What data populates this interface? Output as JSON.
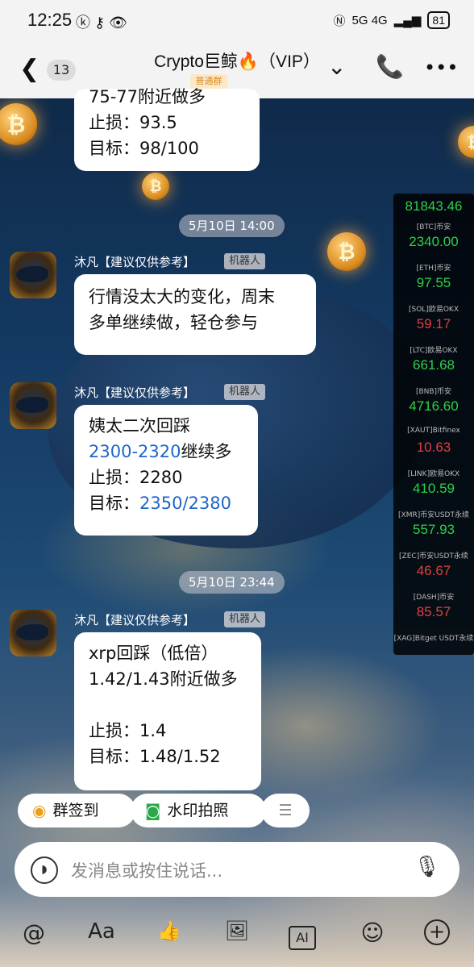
{
  "status": {
    "time": "12:25",
    "network": "5G 4G",
    "battery": "81"
  },
  "header": {
    "back_count": "13",
    "title": "Crypto巨鲸🔥（VIP）",
    "group_tag": "普通群"
  },
  "messages": {
    "top_partial": {
      "line1": "75-77附近做多",
      "line2": "止损：93.5",
      "line3": "目标：98/100"
    },
    "time1": "5月10日 14:00",
    "msg1": {
      "sender": "沐凡【建议仅供参考】",
      "badge": "机器人",
      "line1": "行情没太大的变化，周末",
      "line2": "多单继续做，轻仓参与"
    },
    "msg2": {
      "sender": "沐凡【建议仅供参考】",
      "badge": "机器人",
      "line1": "姨太二次回踩",
      "line2a": "2300-2320",
      "line2b": "继续多",
      "line3": "止损：2280",
      "line4a": "目标：",
      "line4b": "2350/2380"
    },
    "time2": "5月10日 23:44",
    "msg3": {
      "sender": "沐凡【建议仅供参考】",
      "badge": "机器人",
      "line1": "xrp回踩（低倍）",
      "line2": "1.42/1.43附近做多",
      "line3": "止损：1.4",
      "line4": "目标：1.48/1.52"
    }
  },
  "ticker": {
    "top_value": "81843.46",
    "rows": [
      {
        "label": "[BTC]币安",
        "value": "2340.00",
        "color": "#2fd04a"
      },
      {
        "label": "[ETH]币安",
        "value": "97.55",
        "color": "#2fd04a"
      },
      {
        "label": "[SOL]欧易OKX",
        "value": "59.17",
        "color": "#e04040"
      },
      {
        "label": "[LTC]欧易OKX",
        "value": "661.68",
        "color": "#2fd04a"
      },
      {
        "label": "[BNB]币安",
        "value": "4716.60",
        "color": "#2fd04a"
      },
      {
        "label": "[XAUT]Bitfinex",
        "value": "10.63",
        "color": "#e04040"
      },
      {
        "label": "[LINK]欧易OKX",
        "value": "410.59",
        "color": "#2fd04a"
      },
      {
        "label": "[XMR]币安USDT永续",
        "value": "557.93",
        "color": "#2fd04a"
      },
      {
        "label": "[ZEC]币安USDT永续",
        "value": "46.67",
        "color": "#e04040"
      },
      {
        "label": "[DASH]币安",
        "value": "85.57",
        "color": "#e04040"
      },
      {
        "label": "[XAG]Bitget USDT永续",
        "value": "",
        "color": "#2fd04a"
      }
    ]
  },
  "quick_actions": {
    "signin": "群签到",
    "photo": "水印拍照",
    "more": "☰"
  },
  "input": {
    "placeholder": "发消息或按住说话..."
  },
  "toolbar": {
    "at": "@",
    "font": "Aa",
    "like": "👍",
    "image": "🖼",
    "ai": "AI",
    "emoji": "☺",
    "plus": "+"
  },
  "colors": {
    "link_blue": "#1e66c9",
    "up_green": "#2fd04a",
    "down_red": "#e04040",
    "tag_orange": "#d98a1e"
  }
}
